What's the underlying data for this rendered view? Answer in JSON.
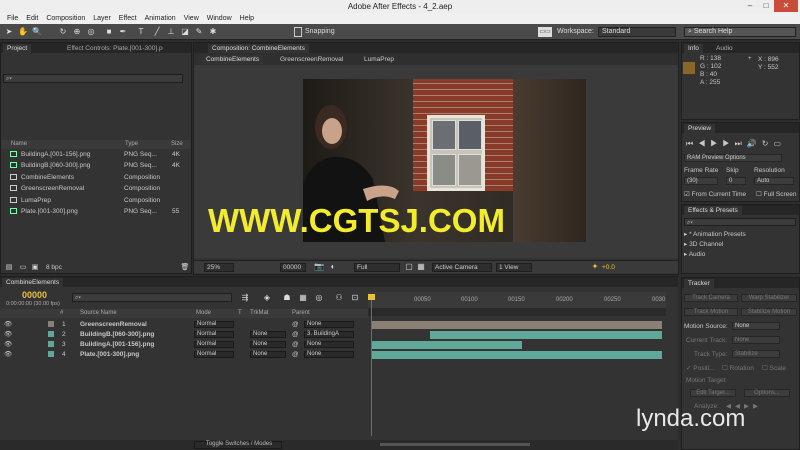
{
  "app": {
    "title": "Adobe After Effects - 4_2.aep",
    "menu": [
      "File",
      "Edit",
      "Composition",
      "Layer",
      "Effect",
      "Animation",
      "View",
      "Window",
      "Help"
    ]
  },
  "toolbar": {
    "snapping_label": "Snapping",
    "workspace_label": "Workspace:",
    "workspace_value": "Standard",
    "search_help_placeholder": "Search Help"
  },
  "project_panel": {
    "tabs": [
      "Project",
      "Effect Controls: Plate.[001-300].p"
    ],
    "columns": [
      "Name",
      "Type",
      "Size"
    ],
    "items": [
      {
        "name": "BuildingA.[001-156].png",
        "type": "PNG Seq...",
        "size": "4K",
        "kind": "footage"
      },
      {
        "name": "BuildingB.[060-300].png",
        "type": "PNG Seq...",
        "size": "4K",
        "kind": "footage"
      },
      {
        "name": "CombineElements",
        "type": "Composition",
        "size": "",
        "kind": "comp"
      },
      {
        "name": "GreenscreenRemoval",
        "type": "Composition",
        "size": "",
        "kind": "comp"
      },
      {
        "name": "LumaPrep",
        "type": "Composition",
        "size": "",
        "kind": "comp"
      },
      {
        "name": "Plate.[001-300].png",
        "type": "PNG Seq...",
        "size": "55",
        "kind": "footage"
      }
    ],
    "bpc": "8 bpc"
  },
  "composition_panel": {
    "tab_title": "Composition: CombineElements",
    "subtabs": [
      "CombineElements",
      "GreenscreenRemoval",
      "LumaPrep"
    ],
    "watermark": "WWW.CGTSJ.COM",
    "zoom": "25%",
    "timecode": "00000",
    "resolution": "Full",
    "camera": "Active Camera",
    "views": "1 View",
    "exposure": "+0.0"
  },
  "info_panel": {
    "tabs": [
      "Info",
      "Audio"
    ],
    "r": "R : 138",
    "g": "G : 102",
    "b": "B : 40",
    "a": "A : 255",
    "x": "X : 896",
    "y": "Y : 552",
    "swatch_color": "#8a6628"
  },
  "preview_panel": {
    "title": "Preview",
    "ram_options": "RAM Preview Options",
    "frame_rate_label": "Frame Rate",
    "skip_label": "Skip",
    "resolution_label": "Resolution",
    "frame_rate_value": "(30)",
    "skip_value": "0",
    "resolution_value": "Auto",
    "from_current_time": "From Current Time",
    "full_screen": "Full Screen"
  },
  "effects_panel": {
    "title": "Effects & Presets",
    "items": [
      "* Animation Presets",
      "3D Channel",
      "Audio"
    ]
  },
  "tracker_panel": {
    "title": "Tracker",
    "track_camera": "Track Camera",
    "warp_stabilizer": "Warp Stabilizer",
    "track_motion": "Track Motion",
    "stabilize_motion": "Stabilize Motion",
    "motion_source_label": "Motion Source:",
    "motion_source_value": "None",
    "current_track": "Current Track:",
    "current_track_value": "None",
    "track_type": "Track Type:",
    "track_type_value": "Stabilize",
    "position": "Positi...",
    "rotation": "Rotation",
    "scale": "Scale",
    "motion_target": "Motion Target:",
    "edit_target": "Edit Target...",
    "options": "Options...",
    "analyze": "Analyze:"
  },
  "timeline": {
    "tab": "CombineElements",
    "timecode": "00000",
    "fps": "0:00:00:00 (30.00 fps)",
    "columns": {
      "num": "#",
      "source": "Source Name",
      "mode": "Mode",
      "t": "T",
      "trkmat": "TrkMat",
      "parent": "Parent"
    },
    "ruler": [
      "00050",
      "00100",
      "00150",
      "00200",
      "00250",
      "0030"
    ],
    "layers": [
      {
        "num": "1",
        "name": "GreenscreenRemoval",
        "mode": "Normal",
        "trkmat": "",
        "parent": "None",
        "color": "#8a8074"
      },
      {
        "num": "2",
        "name": "BuildingB.[060-300].png",
        "mode": "Normal",
        "trkmat": "None",
        "parent": "3. BuildingA",
        "color": "#5fa89a"
      },
      {
        "num": "3",
        "name": "BuildingA.[001-156].png",
        "mode": "Normal",
        "trkmat": "None",
        "parent": "None",
        "color": "#5fa89a"
      },
      {
        "num": "4",
        "name": "Plate.[001-300].png",
        "mode": "Normal",
        "trkmat": "None",
        "parent": "None",
        "color": "#5fa89a"
      }
    ],
    "toggle_label": "Toggle Switches / Modes"
  },
  "branding": {
    "logo_text": "lynda.com"
  }
}
